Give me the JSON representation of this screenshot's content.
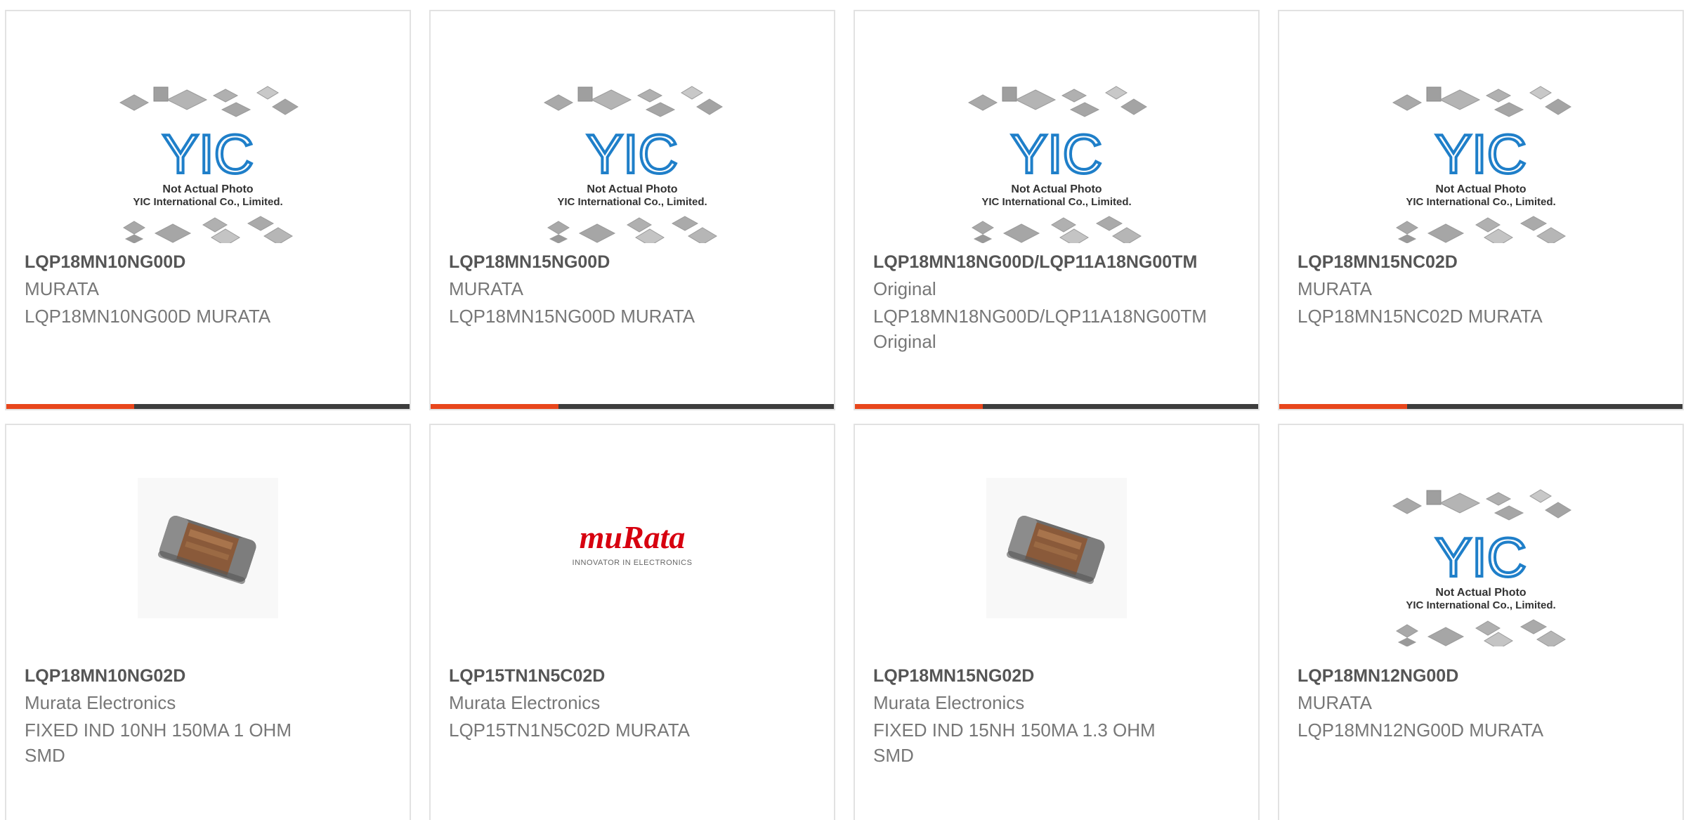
{
  "colors": {
    "accent": "#e8461c",
    "bar": "#3d3d3d",
    "yic_blue": "#1f7fc9",
    "murata_red": "#d7000f"
  },
  "placeholder": {
    "logo_text": "YIC",
    "line1": "Not Actual Photo",
    "line2": "YIC International Co., Limited."
  },
  "murata_logo": {
    "wordmark": "muRata",
    "tagline": "INNOVATOR IN ELECTRONICS"
  },
  "products": [
    {
      "part": "LQP18MN10NG00D",
      "brand": "MURATA",
      "desc": "LQP18MN10NG00D MURATA",
      "image": "yic-placeholder"
    },
    {
      "part": "LQP18MN15NG00D",
      "brand": "MURATA",
      "desc": "LQP18MN15NG00D MURATA",
      "image": "yic-placeholder"
    },
    {
      "part": "LQP18MN18NG00D/LQP11A18NG00TM",
      "brand": "Original",
      "desc": "LQP18MN18NG00D/LQP11A18NG00TM Original",
      "image": "yic-placeholder"
    },
    {
      "part": "LQP18MN15NC02D",
      "brand": "MURATA",
      "desc": "LQP18MN15NC02D MURATA",
      "image": "yic-placeholder"
    },
    {
      "part": "LQP18MN10NG02D",
      "brand": "Murata Electronics",
      "desc": "FIXED IND 10NH 150MA 1 OHM SMD",
      "image": "inductor-chip"
    },
    {
      "part": "LQP15TN1N5C02D",
      "brand": "Murata Electronics",
      "desc": "LQP15TN1N5C02D MURATA",
      "image": "murata-logo"
    },
    {
      "part": "LQP18MN15NG02D",
      "brand": "Murata Electronics",
      "desc": "FIXED IND 15NH 150MA 1.3 OHM SMD",
      "image": "inductor-chip"
    },
    {
      "part": "LQP18MN12NG00D",
      "brand": "MURATA",
      "desc": "LQP18MN12NG00D MURATA",
      "image": "yic-placeholder"
    }
  ]
}
